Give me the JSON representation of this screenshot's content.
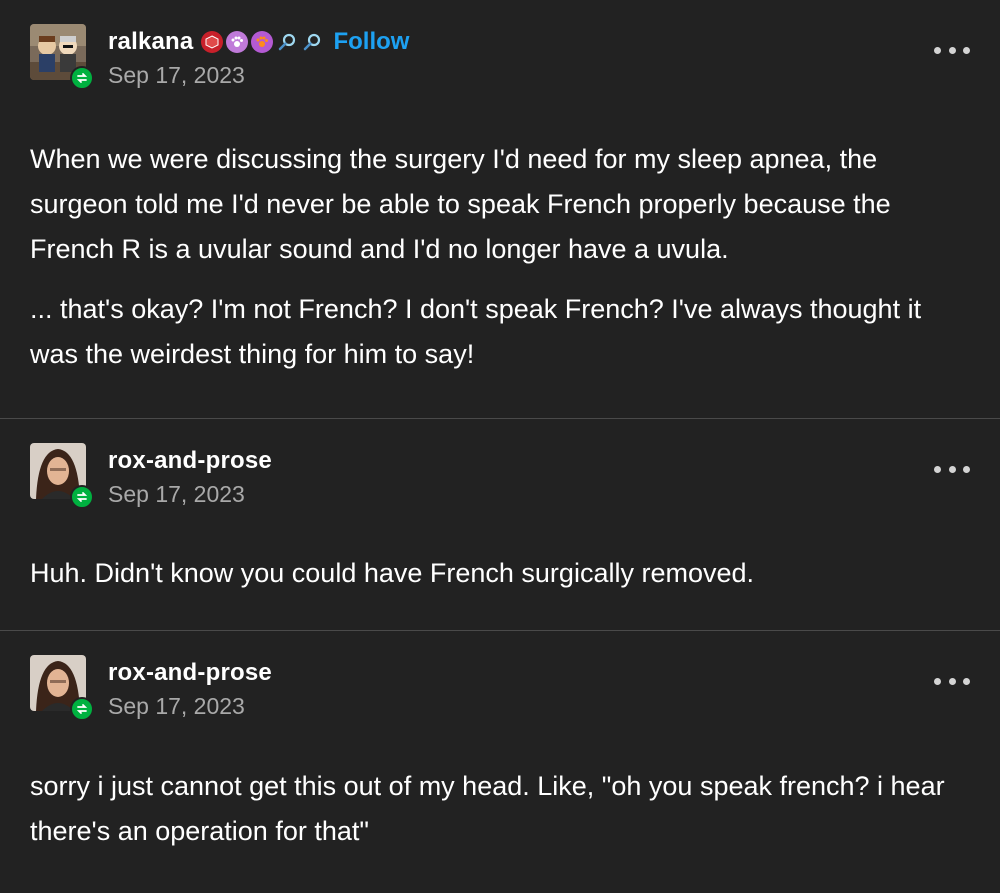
{
  "posts": [
    {
      "username": "ralkana",
      "follow_label": "Follow",
      "date": "Sep 17, 2023",
      "avatar": "avatar-ralkana",
      "badges": [
        "dice-badge-icon",
        "paw-badge-icon",
        "paw-orange-badge-icon",
        "magnifier-icon",
        "magnifier-icon"
      ],
      "paragraphs": [
        "When we were discussing the surgery I'd need for my sleep apnea, the surgeon told me I'd never be able to speak French properly because the French R is a uvular sound and I'd no longer have a uvula.",
        "... that's okay? I'm not French? I don't speak French? I've always thought it was the weirdest thing for him to say!"
      ]
    },
    {
      "username": "rox-and-prose",
      "date": "Sep 17, 2023",
      "avatar": "avatar-rox-and-prose",
      "paragraphs": [
        "Huh. Didn't know you could have French surgically removed."
      ]
    },
    {
      "username": "rox-and-prose",
      "date": "Sep 17, 2023",
      "avatar": "avatar-rox-and-prose",
      "paragraphs": [
        "sorry i just cannot get this out of my head. Like, \"oh you speak french? i hear there's an operation for that\""
      ]
    }
  ],
  "colors": {
    "background": "#222222",
    "follow": "#1da1f2",
    "reblog_badge": "#00b140",
    "divider": "#4a4a4a"
  }
}
